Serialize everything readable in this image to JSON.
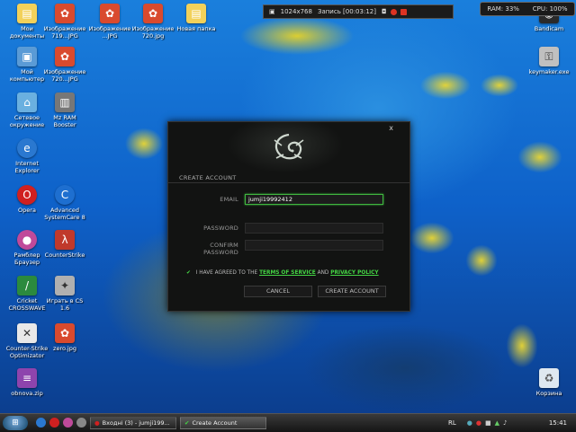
{
  "desktop_icons": [
    {
      "label": "Мои\nдокументы",
      "icon": "folder-icon",
      "color": "#f2d15a"
    },
    {
      "label": "Изображение\n719...JPG",
      "icon": "image-icon",
      "color": "#d94a2e"
    },
    {
      "label": "Изображение\n...JPG",
      "icon": "image-icon",
      "color": "#d94a2e"
    },
    {
      "label": "Изображение\n720.jpg",
      "icon": "image-icon",
      "color": "#d94a2e"
    },
    {
      "label": "Новая папка",
      "icon": "folder-icon",
      "color": "#f2d15a"
    },
    {
      "label": "Мой\nкомпьютер",
      "icon": "computer-icon",
      "color": "#5a9bd6"
    },
    {
      "label": "Изображение\n720...JPG",
      "icon": "image-icon",
      "color": "#d94a2e"
    },
    {
      "label": "Сетевое\nокружение",
      "icon": "network-icon",
      "color": "#6ab0e0"
    },
    {
      "label": "Mz RAM\nBooster",
      "icon": "ram-booster-icon",
      "color": "#777777"
    },
    {
      "label": "Internet\nExplorer",
      "icon": "internet-explorer-icon",
      "color": "#2a78d0"
    },
    {
      "label": "Opera",
      "icon": "opera-icon",
      "color": "#d02020"
    },
    {
      "label": "Advanced\nSystemCare 8",
      "icon": "systemcare-icon",
      "color": "#1e6fd0"
    },
    {
      "label": "Рамблер\nБраузер",
      "icon": "rambler-browser-icon",
      "color": "#c04a9a"
    },
    {
      "label": "CounterStrike",
      "icon": "counter-strike-icon",
      "color": "#c0392b"
    },
    {
      "label": "Cricket\nCROSSWAVE",
      "icon": "cricket-icon",
      "color": "#2b8a3e"
    },
    {
      "label": "Играть в CS\n1.6",
      "icon": "cs16-icon",
      "color": "#b0b0b0"
    },
    {
      "label": "Counter-Strike\nOptimizator",
      "icon": "cs-optimizator-icon",
      "color": "#e8e8e8"
    },
    {
      "label": "zero.jpg",
      "icon": "image-icon",
      "color": "#d94a2e"
    },
    {
      "label": "obnova.zip",
      "icon": "zip-archive-icon",
      "color": "#8e44ad"
    },
    {
      "label": "Bandicam",
      "icon": "bandicam-icon",
      "color": "#2a2a2a"
    },
    {
      "label": "keymaker.exe",
      "icon": "keymaker-icon",
      "color": "#c0c0c0"
    },
    {
      "label": "Корзина",
      "icon": "recycle-bin-icon",
      "color": "#dfe8f0"
    }
  ],
  "recorder": {
    "resolution": "1024x768",
    "status": "Запись [00:03:12]"
  },
  "sysmon": {
    "ram": "RAM: 33%",
    "cpu": "CPU: 100%"
  },
  "dialog": {
    "close": "x",
    "title": "CREATE ACCOUNT",
    "email_label": "EMAIL",
    "email_value": "jumji19992412",
    "password_label": "PASSWORD",
    "password_value": "",
    "confirm_label": "CONFIRM PASSWORD",
    "confirm_value": "",
    "agree_checkmark": "✔",
    "agree_text": "I HAVE AGREED TO THE",
    "agree_terms": "TERMS OF SERVICE",
    "agree_and": "AND",
    "agree_privacy": "PRIVACY POLICY",
    "cancel": "CANCEL",
    "create": "CREATE ACCOUNT",
    "accent": "#44d444"
  },
  "taskbar": {
    "start_glyph": "⊞",
    "tasks": [
      {
        "label": "Входні (3) - jumji199...",
        "icon": "opera-icon"
      },
      {
        "label": "Create Account",
        "icon": "razer-icon"
      }
    ],
    "lang": "RL",
    "clock": "15:41"
  }
}
